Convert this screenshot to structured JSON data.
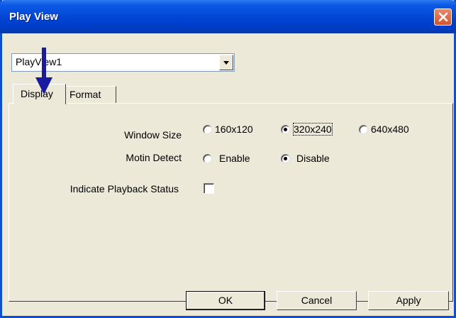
{
  "window": {
    "title": "Play View"
  },
  "selector": {
    "value": "PlayView1"
  },
  "tabs": [
    {
      "label": "Display",
      "selected": true
    },
    {
      "label": "Format",
      "selected": false
    }
  ],
  "display": {
    "window_size": {
      "label": "Window Size",
      "options": [
        "160x120",
        "320x240",
        "640x480"
      ],
      "selected": "320x240"
    },
    "motion_detect": {
      "label": "Motin Detect",
      "options": [
        "Enable",
        "Disable"
      ],
      "selected": "Disable"
    },
    "playback_status": {
      "label": "Indicate Playback Status",
      "checked": false
    }
  },
  "buttons": {
    "ok": "OK",
    "cancel": "Cancel",
    "apply": "Apply"
  },
  "colors": {
    "titlebar": "#0044D4",
    "dialog_bg": "#ECE9D8",
    "annotation_arrow": "#1A1AA0",
    "close_button": "#D4542D"
  }
}
